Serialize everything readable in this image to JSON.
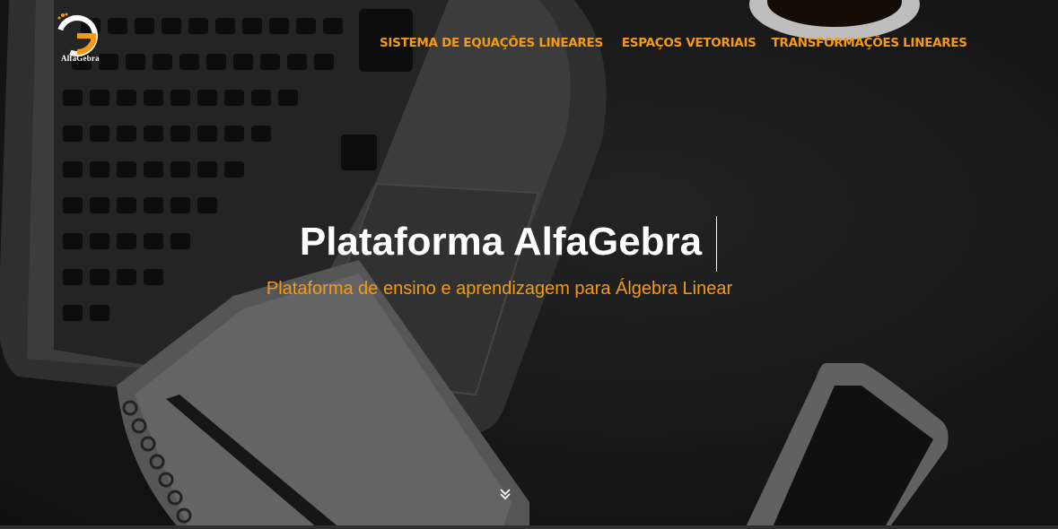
{
  "brand": {
    "logo_text": "AlfaGebra",
    "logo_icon": "alfagebra-logo-icon",
    "accent_color": "#f59a12"
  },
  "nav": {
    "items": [
      {
        "label": "SISTEMA DE EQUAÇÕES LINEARES"
      },
      {
        "label": "ESPAÇOS VETORIAIS"
      },
      {
        "label": "TRANSFORMAÇÕES LINEARES"
      }
    ]
  },
  "hero": {
    "title": "Plataforma AlfaGebra",
    "subtitle": "Plataforma de ensino e aprendizagem para Álgebra Linear",
    "scroll_icon": "double-chevron-down-icon"
  }
}
